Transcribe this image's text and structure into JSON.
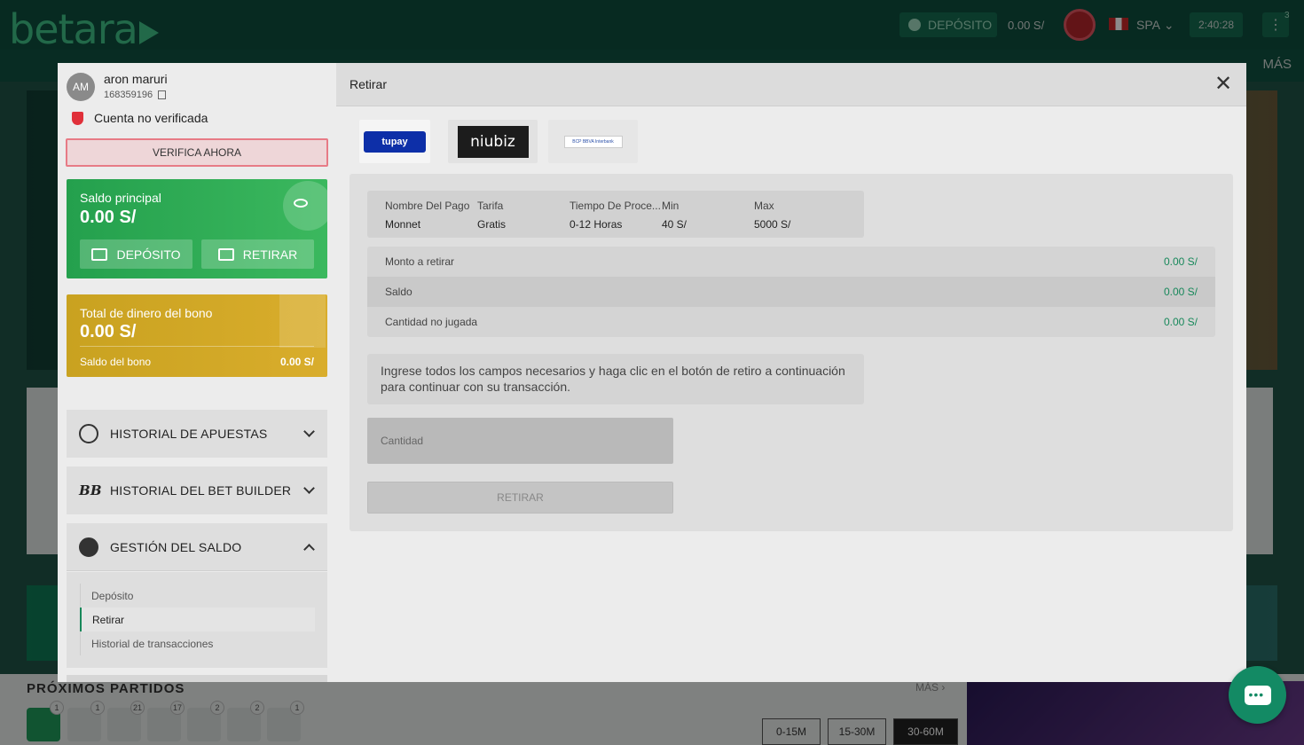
{
  "site": {
    "logo": "betara",
    "header": {
      "deposit_label": "DEPÓSITO",
      "balance": "0.00 S/",
      "language": "SPA",
      "clock": "2:40:28",
      "notifications": "3",
      "more_label": "MÁS"
    },
    "upcoming": {
      "title": "PRÓXIMOS PARTIDOS",
      "more_label": "MÁS",
      "sport_counts": [
        "1",
        "1",
        "21",
        "17",
        "2",
        "2",
        "1"
      ],
      "time_filters": [
        "0-15M",
        "15-30M",
        "30-60M"
      ],
      "selected_filter": "30-60M"
    }
  },
  "account": {
    "initials": "AM",
    "name": "aron maruri",
    "user_id": "168359196",
    "status": "Cuenta no verificada",
    "verify_label": "VERIFICA AHORA",
    "main_balance_label": "Saldo principal",
    "main_balance": "0.00 S/",
    "deposit_label": "DEPÓSITO",
    "withdraw_label": "RETIRAR",
    "bonus_label": "Total de dinero del bono",
    "bonus_total": "0.00 S/",
    "bonus_balance_label": "Saldo del bono",
    "bonus_balance": "0.00 S/"
  },
  "menu": {
    "bet_history": "HISTORIAL DE APUESTAS",
    "bet_builder_history": "HISTORIAL DEL BET BUILDER",
    "balance_management": "GESTIÓN DEL SALDO",
    "sub_items": [
      "Depósito",
      "Retirar",
      "Historial de transacciones"
    ]
  },
  "withdraw": {
    "title": "Retirar",
    "payment_methods": [
      "tupay",
      "niubiz",
      "bancos"
    ],
    "tupay_logo_text": "tupay",
    "niubiz_logo_text": "niubiz",
    "bancos_logo_text": "BCP BBVA Interbank",
    "info_headers": [
      "Nombre Del Pago",
      "Tarifa",
      "Tiempo De Proce...",
      "Min",
      "Max"
    ],
    "info_values": [
      "Monnet",
      "Gratis",
      "0-12 Horas",
      "40 S/",
      "5000 S/"
    ],
    "summary": [
      {
        "label": "Monto a retirar",
        "value": "0.00 S/"
      },
      {
        "label": "Saldo",
        "value": "0.00 S/"
      },
      {
        "label": "Cantidad no jugada",
        "value": "0.00 S/"
      }
    ],
    "note": "Ingrese todos los campos necesarios y haga clic en el botón de retiro a continuación para continuar con su transacción.",
    "amount_placeholder": "Cantidad",
    "submit_label": "RETIRAR"
  },
  "colors": {
    "accent_green": "#17885a",
    "balance_card": "#2fa956",
    "bonus_card": "#d1a727"
  }
}
